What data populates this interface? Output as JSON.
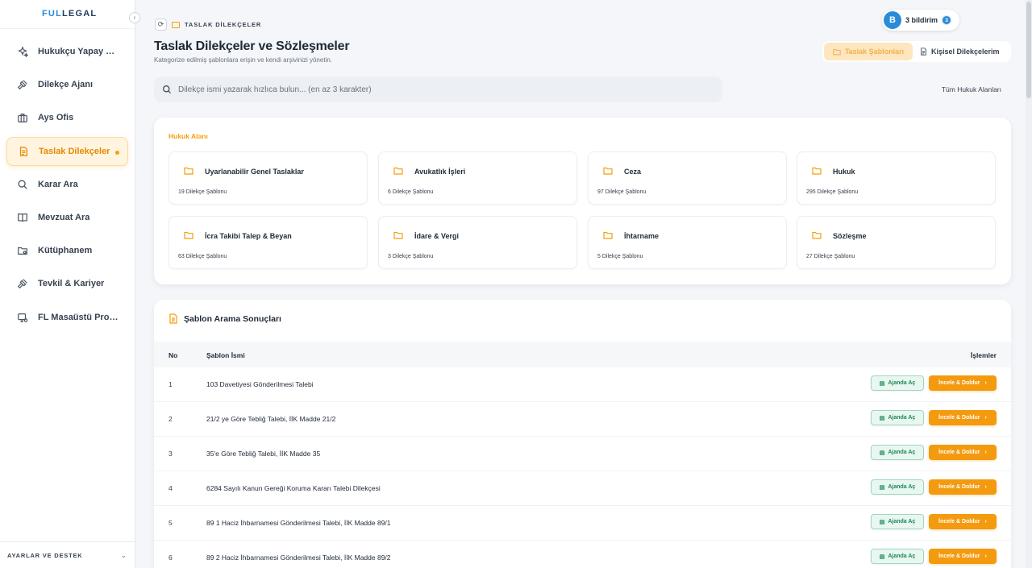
{
  "app": {
    "logo_prefix": "FUL",
    "logo_suffix": "LEGAL"
  },
  "sidebar": {
    "items": [
      {
        "label": "Hukukçu Yapay Zeka",
        "icon": "sparkle-icon"
      },
      {
        "label": "Dilekçe Ajanı",
        "icon": "gavel-icon"
      },
      {
        "label": "Ays Ofis",
        "icon": "briefcase-icon"
      },
      {
        "label": "Taslak Dilekçeler",
        "icon": "document-icon",
        "active": true
      },
      {
        "label": "Karar Ara",
        "icon": "search-icon"
      },
      {
        "label": "Mevzuat Ara",
        "icon": "book-icon"
      },
      {
        "label": "Kütüphanem",
        "icon": "library-icon"
      },
      {
        "label": "Tevkil & Kariyer",
        "icon": "gavel-icon"
      },
      {
        "label": "FL Masaüstü Programı",
        "icon": "desktop-icon"
      }
    ],
    "footer_label": "AYARLAR VE DESTEK"
  },
  "breadcrumb": {
    "label": "TASLAK DİLEKÇELER"
  },
  "notifications": {
    "avatar_initial": "B",
    "label": "3 bildirim",
    "count": "3"
  },
  "page": {
    "title": "Taslak Dilekçeler ve Sözleşmeler",
    "subtitle": "Kategorize edilmiş şablonlara erişin ve kendi arşivinizi yönetin."
  },
  "tabs": [
    {
      "label": "Taslak Şablonları",
      "active": true
    },
    {
      "label": "Kişisel Dilekçelerim",
      "active": false
    }
  ],
  "search": {
    "placeholder": "Dilekçe ismi yazarak hızlıca bulun... (en az 3 karakter)",
    "value": "",
    "area_filter": "Tüm Hukuk Alanları"
  },
  "categories": {
    "heading": "Hukuk Alanı",
    "items": [
      {
        "name": "Uyarlanabilir Genel Taslaklar",
        "count": "19 Dilekçe Şablonu"
      },
      {
        "name": "Avukatlık İşleri",
        "count": "6 Dilekçe Şablonu"
      },
      {
        "name": "Ceza",
        "count": "97 Dilekçe Şablonu"
      },
      {
        "name": "Hukuk",
        "count": "295 Dilekçe Şablonu"
      },
      {
        "name": "İcra Takibi Talep & Beyan",
        "count": "63 Dilekçe Şablonu"
      },
      {
        "name": "İdare & Vergi",
        "count": "3 Dilekçe Şablonu"
      },
      {
        "name": "İhtarname",
        "count": "5 Dilekçe Şablonu"
      },
      {
        "name": "Sözleşme",
        "count": "27 Dilekçe Şablonu"
      }
    ]
  },
  "results": {
    "title": "Şablon Arama Sonuçları",
    "columns": {
      "no": "No",
      "name": "Şablon İsmi",
      "actions": "İşlemler"
    },
    "ajanda_label": "Ajanda Aç",
    "incele_label": "İncele & Doldur",
    "rows": [
      {
        "no": "1",
        "name": "103 Davetiyesi Gönderilmesi Talebi"
      },
      {
        "no": "2",
        "name": "21/2 ye Göre Tebliğ Talebi, İİK Madde 21/2"
      },
      {
        "no": "3",
        "name": "35'e Göre Tebliğ Talebi, İİK Madde 35"
      },
      {
        "no": "4",
        "name": "6284 Sayılı Kanun Gereği Koruma Kararı Talebi Dilekçesi"
      },
      {
        "no": "5",
        "name": "89 1 Haciz İhbarnamesi Gönderilmesi Talebi, İİK Madde 89/1"
      },
      {
        "no": "6",
        "name": "89 2 Haciz İhbarnamesi Gönderilmesi Talebi, İİK Madde 89/2"
      }
    ]
  },
  "colors": {
    "accent": "#f59e0b",
    "primary": "#2a8bd8",
    "success": "#1f8a5b"
  }
}
